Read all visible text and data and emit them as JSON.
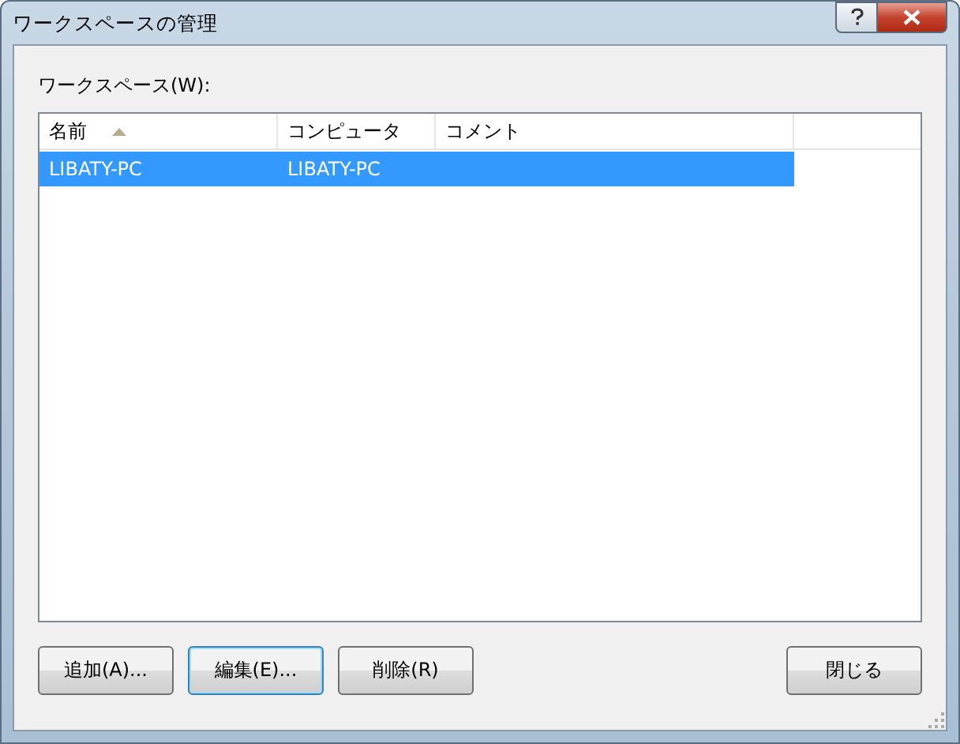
{
  "window": {
    "title": "ワークスペースの管理"
  },
  "workspaces_label": "ワークスペース(W):",
  "table": {
    "columns": [
      {
        "label": "名前",
        "sort_ascending": true
      },
      {
        "label": "コンピュータ",
        "sort_ascending": false
      },
      {
        "label": "コメント",
        "sort_ascending": false
      }
    ],
    "rows": [
      {
        "cells": [
          "LIBATY-PC",
          "LIBATY-PC",
          ""
        ],
        "selected": true
      }
    ]
  },
  "left_buttons": [
    {
      "label": "追加(A)...",
      "focused": false
    },
    {
      "label": "編集(E)...",
      "focused": true
    },
    {
      "label": "削除(R)",
      "focused": false
    }
  ],
  "right_buttons": [
    {
      "label": "閉じる",
      "focused": false
    }
  ]
}
